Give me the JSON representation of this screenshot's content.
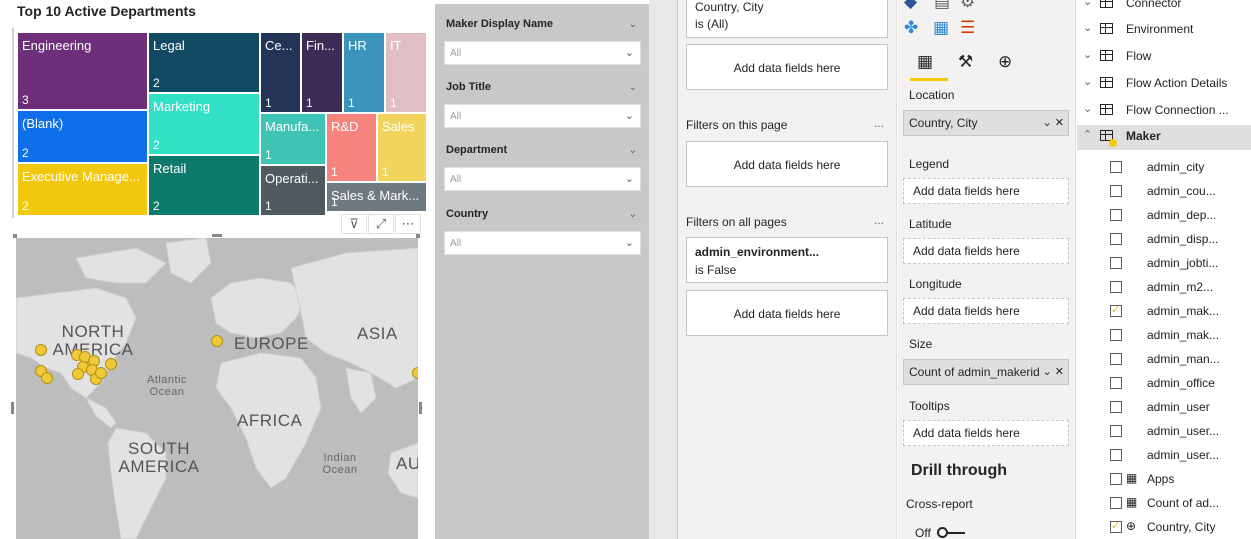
{
  "report": {
    "treemap": {
      "title": "Top 10 Active Departments",
      "tiles": [
        {
          "label": "Engineering",
          "count": "3",
          "color": "#6d2f79"
        },
        {
          "label": "Legal",
          "count": "2",
          "color": "#134a63"
        },
        {
          "label": "Ce...",
          "count": "1",
          "color": "#233458"
        },
        {
          "label": "Fin...",
          "count": "1",
          "color": "#3d2d56"
        },
        {
          "label": "HR",
          "count": "1",
          "color": "#3a94bb"
        },
        {
          "label": "IT",
          "count": "1",
          "color": "#dfbfc3"
        },
        {
          "label": "(Blank)",
          "count": "2",
          "color": "#0e6fe8"
        },
        {
          "label": "Marketing",
          "count": "2",
          "color": "#32e1c5"
        },
        {
          "label": "Manufa...",
          "count": "1",
          "color": "#3ec4b4"
        },
        {
          "label": "R&D",
          "count": "1",
          "color": "#f6837d"
        },
        {
          "label": "Sales",
          "count": "1",
          "color": "#f2d35e"
        },
        {
          "label": "Executive Manage...",
          "count": "2",
          "color": "#f2c80f"
        },
        {
          "label": "Retail",
          "count": "2",
          "color": "#0d7b6c"
        },
        {
          "label": "Operati...",
          "count": "1",
          "color": "#4f5a5f"
        },
        {
          "label": "Sales & Mark...",
          "count": "1",
          "color": "#6f7a80"
        }
      ]
    },
    "map": {
      "labels": {
        "north_america": "NORTH AMERICA",
        "europe": "EUROPE",
        "asia": "ASIA",
        "atlantic": "Atlantic Ocean",
        "africa": "AFRICA",
        "south_america": "SOUTH AMERICA",
        "indian": "Indian Ocean",
        "australia": "AU"
      }
    }
  },
  "slicers": [
    {
      "title": "Maker Display Name",
      "value": "All"
    },
    {
      "title": "Job Title",
      "value": "All"
    },
    {
      "title": "Department",
      "value": "All"
    },
    {
      "title": "Country",
      "value": "All"
    }
  ],
  "filters": {
    "top_card": {
      "name": "Country, City",
      "state": "is (All)"
    },
    "add_label": "Add data fields here",
    "on_page": "Filters on this page",
    "on_all": "Filters on all pages",
    "all_card": {
      "name": "admin_environment...",
      "state": "is False"
    },
    "more": "..."
  },
  "viz": {
    "location_label": "Location",
    "location_value": "Country, City",
    "legend_label": "Legend",
    "latitude_label": "Latitude",
    "longitude_label": "Longitude",
    "size_label": "Size",
    "size_value": "Count of admin_makerid",
    "tooltips_label": "Tooltips",
    "well_placeholder": "Add data fields here",
    "drill_title": "Drill through",
    "cross_report": "Cross-report",
    "toggle_state": "Off"
  },
  "fields": {
    "tables": [
      "Connector",
      "Environment",
      "Flow",
      "Flow Action Details",
      "Flow Connection ...",
      "Maker"
    ],
    "maker_fields": [
      {
        "name": "admin_city",
        "checked": false
      },
      {
        "name": "admin_cou...",
        "checked": false
      },
      {
        "name": "admin_dep...",
        "checked": false
      },
      {
        "name": "admin_disp...",
        "checked": false
      },
      {
        "name": "admin_jobti...",
        "checked": false
      },
      {
        "name": "admin_m2...",
        "checked": false
      },
      {
        "name": "admin_mak...",
        "checked": true
      },
      {
        "name": "admin_mak...",
        "checked": false
      },
      {
        "name": "admin_man...",
        "checked": false
      },
      {
        "name": "admin_office",
        "checked": false
      },
      {
        "name": "admin_user",
        "checked": false
      },
      {
        "name": "admin_user...",
        "checked": false
      },
      {
        "name": "admin_user...",
        "checked": false
      },
      {
        "name": "Apps",
        "checked": false
      },
      {
        "name": "Count of ad...",
        "checked": false
      },
      {
        "name": "Country, City",
        "checked": true
      }
    ]
  }
}
